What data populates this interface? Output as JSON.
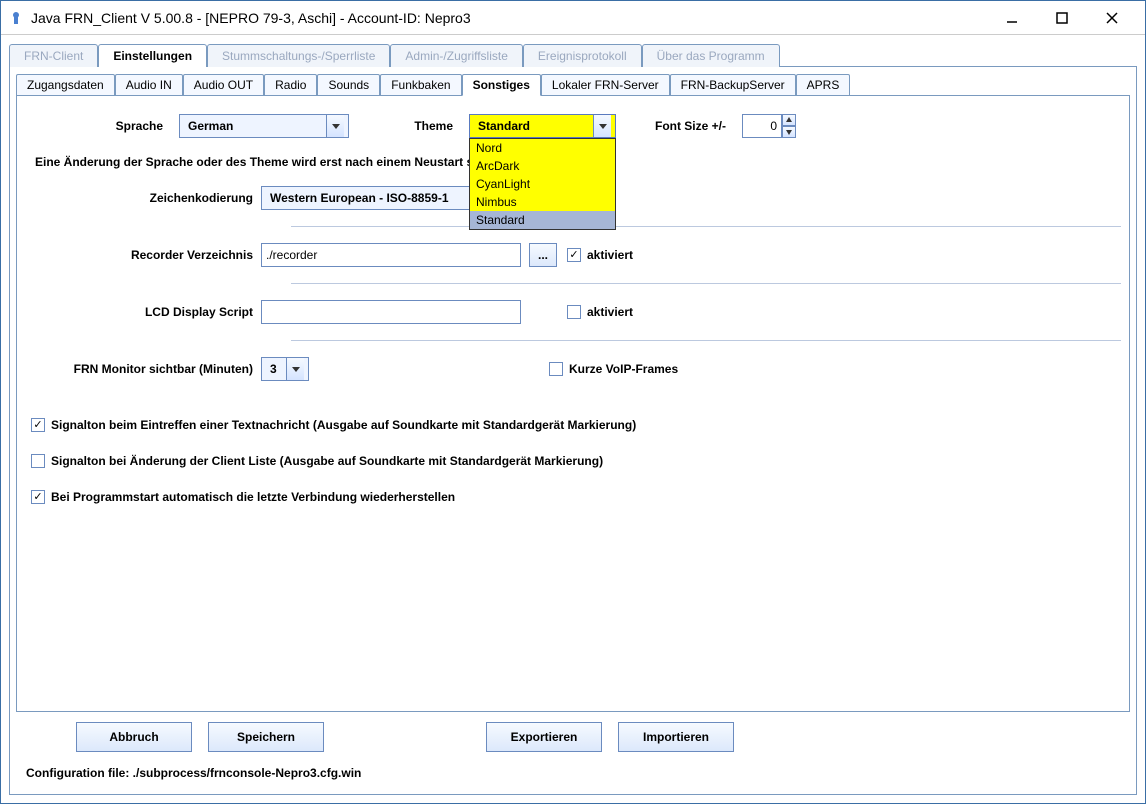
{
  "window": {
    "title": "Java FRN_Client V 5.00.8 - [NEPRO 79-3, Aschi] - Account-ID: Nepro3"
  },
  "outerTabs": [
    "FRN-Client",
    "Einstellungen",
    "Stummschaltungs-/Sperrliste",
    "Admin-/Zugriffsliste",
    "Ereignisprotokoll",
    "Über das Programm"
  ],
  "outerActive": 1,
  "innerTabs": [
    "Zugangsdaten",
    "Audio IN",
    "Audio OUT",
    "Radio",
    "Sounds",
    "Funkbaken",
    "Sonstiges",
    "Lokaler FRN-Server",
    "FRN-BackupServer",
    "APRS"
  ],
  "innerActive": 6,
  "labels": {
    "sprache": "Sprache",
    "theme": "Theme",
    "fontsize": "Font Size +/-",
    "hint": "Eine Änderung der Sprache oder des Theme wird erst nach einem Neustart sam!",
    "encoding": "Zeichenkodierung",
    "recorder": "Recorder Verzeichnis",
    "aktiviert1": "aktiviert",
    "lcd": "LCD Display Script",
    "aktiviert2": "aktiviert",
    "monitor": "FRN Monitor sichtbar (Minuten)",
    "voip": "Kurze VoIP-Frames",
    "sig1": "Signalton beim Eintreffen einer Textnachricht (Ausgabe auf Soundkarte mit Standardgerät Markierung)",
    "sig2": "Signalton bei Änderung der Client Liste (Ausgabe auf Soundkarte mit Standardgerät Markierung)",
    "autoconn": "Bei Programmstart automatisch die letzte Verbindung wiederherstellen"
  },
  "values": {
    "sprache": "German",
    "theme": "Standard",
    "fontsize": "0",
    "encoding": "Western European - ISO-8859-1",
    "recorder": "./recorder",
    "lcd": "",
    "monitor": "3",
    "browse": "..."
  },
  "themeOptions": [
    "Nord",
    "ArcDark",
    "CyanLight",
    "Nimbus",
    "Standard"
  ],
  "themeSelected": 4,
  "checks": {
    "recorderAkt": true,
    "lcdAkt": false,
    "voip": false,
    "sig1": true,
    "sig2": false,
    "autoconn": true
  },
  "buttons": {
    "abbruch": "Abbruch",
    "speichern": "Speichern",
    "export": "Exportieren",
    "import": "Importieren"
  },
  "configLine": "Configuration file: ./subprocess/frnconsole-Nepro3.cfg.win"
}
